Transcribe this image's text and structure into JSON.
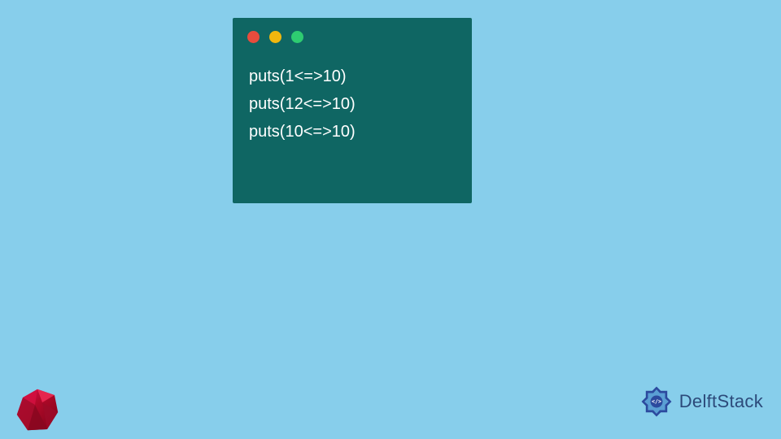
{
  "code": {
    "lines": [
      "puts(1<=>10)",
      "puts(12<=>10)",
      "puts(10<=>10)"
    ]
  },
  "branding": {
    "site_name": "DelftStack"
  }
}
